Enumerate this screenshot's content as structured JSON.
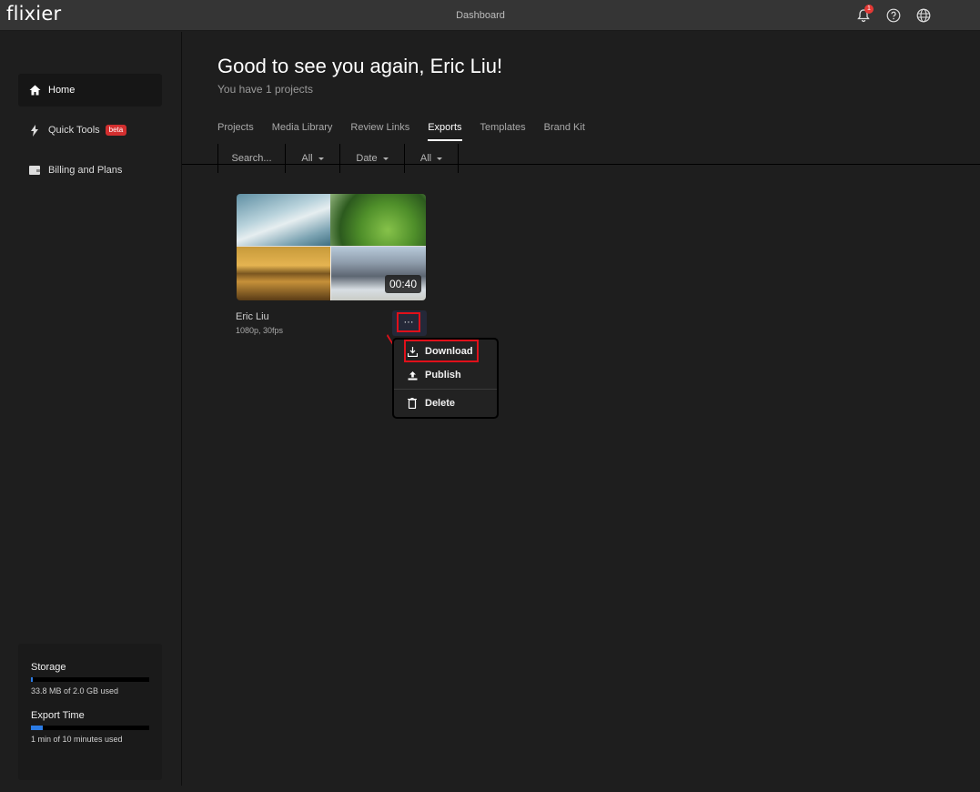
{
  "app": {
    "logo": "flixier",
    "title": "Dashboard",
    "notification_count": "1"
  },
  "icons": {
    "notifications": "bell-icon",
    "help": "question-circle-icon",
    "language": "globe-icon"
  },
  "sidebar": {
    "items": [
      {
        "label": "Home",
        "icon": "home-icon",
        "active": true
      },
      {
        "label": "Quick Tools",
        "icon": "lightning-icon",
        "badge": "beta"
      },
      {
        "label": "Billing and Plans",
        "icon": "wallet-icon"
      }
    ],
    "usage": {
      "storage": {
        "label": "Storage",
        "text": "33.8 MB of 2.0 GB used",
        "fraction": 0.017
      },
      "export_time": {
        "label": "Export Time",
        "text": "1 min of 10 minutes used",
        "fraction": 0.1
      }
    }
  },
  "main": {
    "greeting": "Good to see you again, Eric Liu!",
    "subtext": "You have 1 projects",
    "tabs": [
      {
        "label": "Projects"
      },
      {
        "label": "Media Library"
      },
      {
        "label": "Review Links"
      },
      {
        "label": "Exports",
        "active": true
      },
      {
        "label": "Templates"
      },
      {
        "label": "Brand Kit"
      }
    ],
    "filters": {
      "search_placeholder": "Search...",
      "type": "All",
      "sort": "Date",
      "status": "All"
    },
    "exports": [
      {
        "name": "Eric Liu",
        "meta": "1080p, 30fps",
        "duration": "00:40"
      }
    ],
    "context_menu": {
      "items": [
        {
          "label": "Download",
          "icon": "download-icon",
          "highlighted": true
        },
        {
          "label": "Publish",
          "icon": "upload-icon"
        },
        {
          "label": "Delete",
          "icon": "trash-icon"
        }
      ]
    },
    "more_button_label": "···"
  },
  "colors": {
    "accent": "#2b7be4",
    "highlight": "#e0101a",
    "badge": "#d32f2f"
  }
}
